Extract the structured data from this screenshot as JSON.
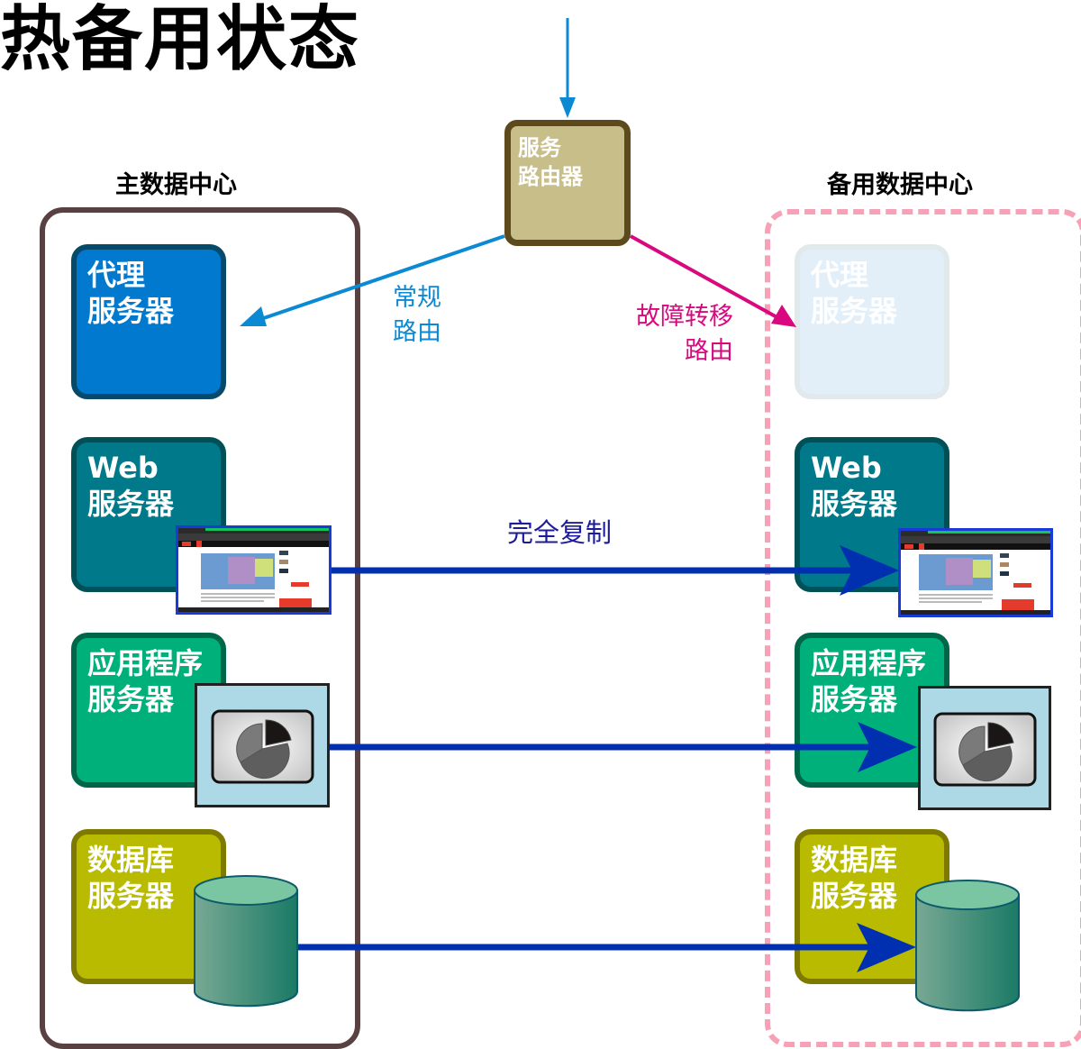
{
  "title": "热备用状态",
  "router": {
    "label_line1": "服务",
    "label_line2": "路由器"
  },
  "routes": {
    "normal": {
      "line1": "常规",
      "line2": "路由",
      "color": "#0b8ad3"
    },
    "failover": {
      "line1": "故障转移",
      "line2": "路由",
      "color": "#d9087f"
    }
  },
  "replication": {
    "label": "完全复制",
    "color": "#0030b0"
  },
  "primary_dc": {
    "label": "主数据中心",
    "servers": [
      {
        "line1": "代理",
        "line2": "服务器",
        "fill": "#0079cf",
        "border": "#054a6a"
      },
      {
        "line1": "Web",
        "line2": "服务器",
        "fill": "#00798a",
        "border": "#005058"
      },
      {
        "line1": "应用程序",
        "line2": "服务器",
        "fill": "#00b07a",
        "border": "#00664a"
      },
      {
        "line1": "数据库",
        "line2": "服务器",
        "fill": "#b8bb00",
        "border": "#7e7a00"
      }
    ]
  },
  "standby_dc": {
    "label": "备用数据中心",
    "servers": [
      {
        "line1": "代理",
        "line2": "服务器",
        "fill": "#e2eff9",
        "border": "#e1e9ec",
        "state": "inactive"
      },
      {
        "line1": "Web",
        "line2": "服务器",
        "fill": "#00798a",
        "border": "#005058"
      },
      {
        "line1": "应用程序",
        "line2": "服务器",
        "fill": "#00b07a",
        "border": "#00664a"
      },
      {
        "line1": "数据库",
        "line2": "服务器",
        "fill": "#b8bb00",
        "border": "#7e7a00"
      }
    ]
  }
}
